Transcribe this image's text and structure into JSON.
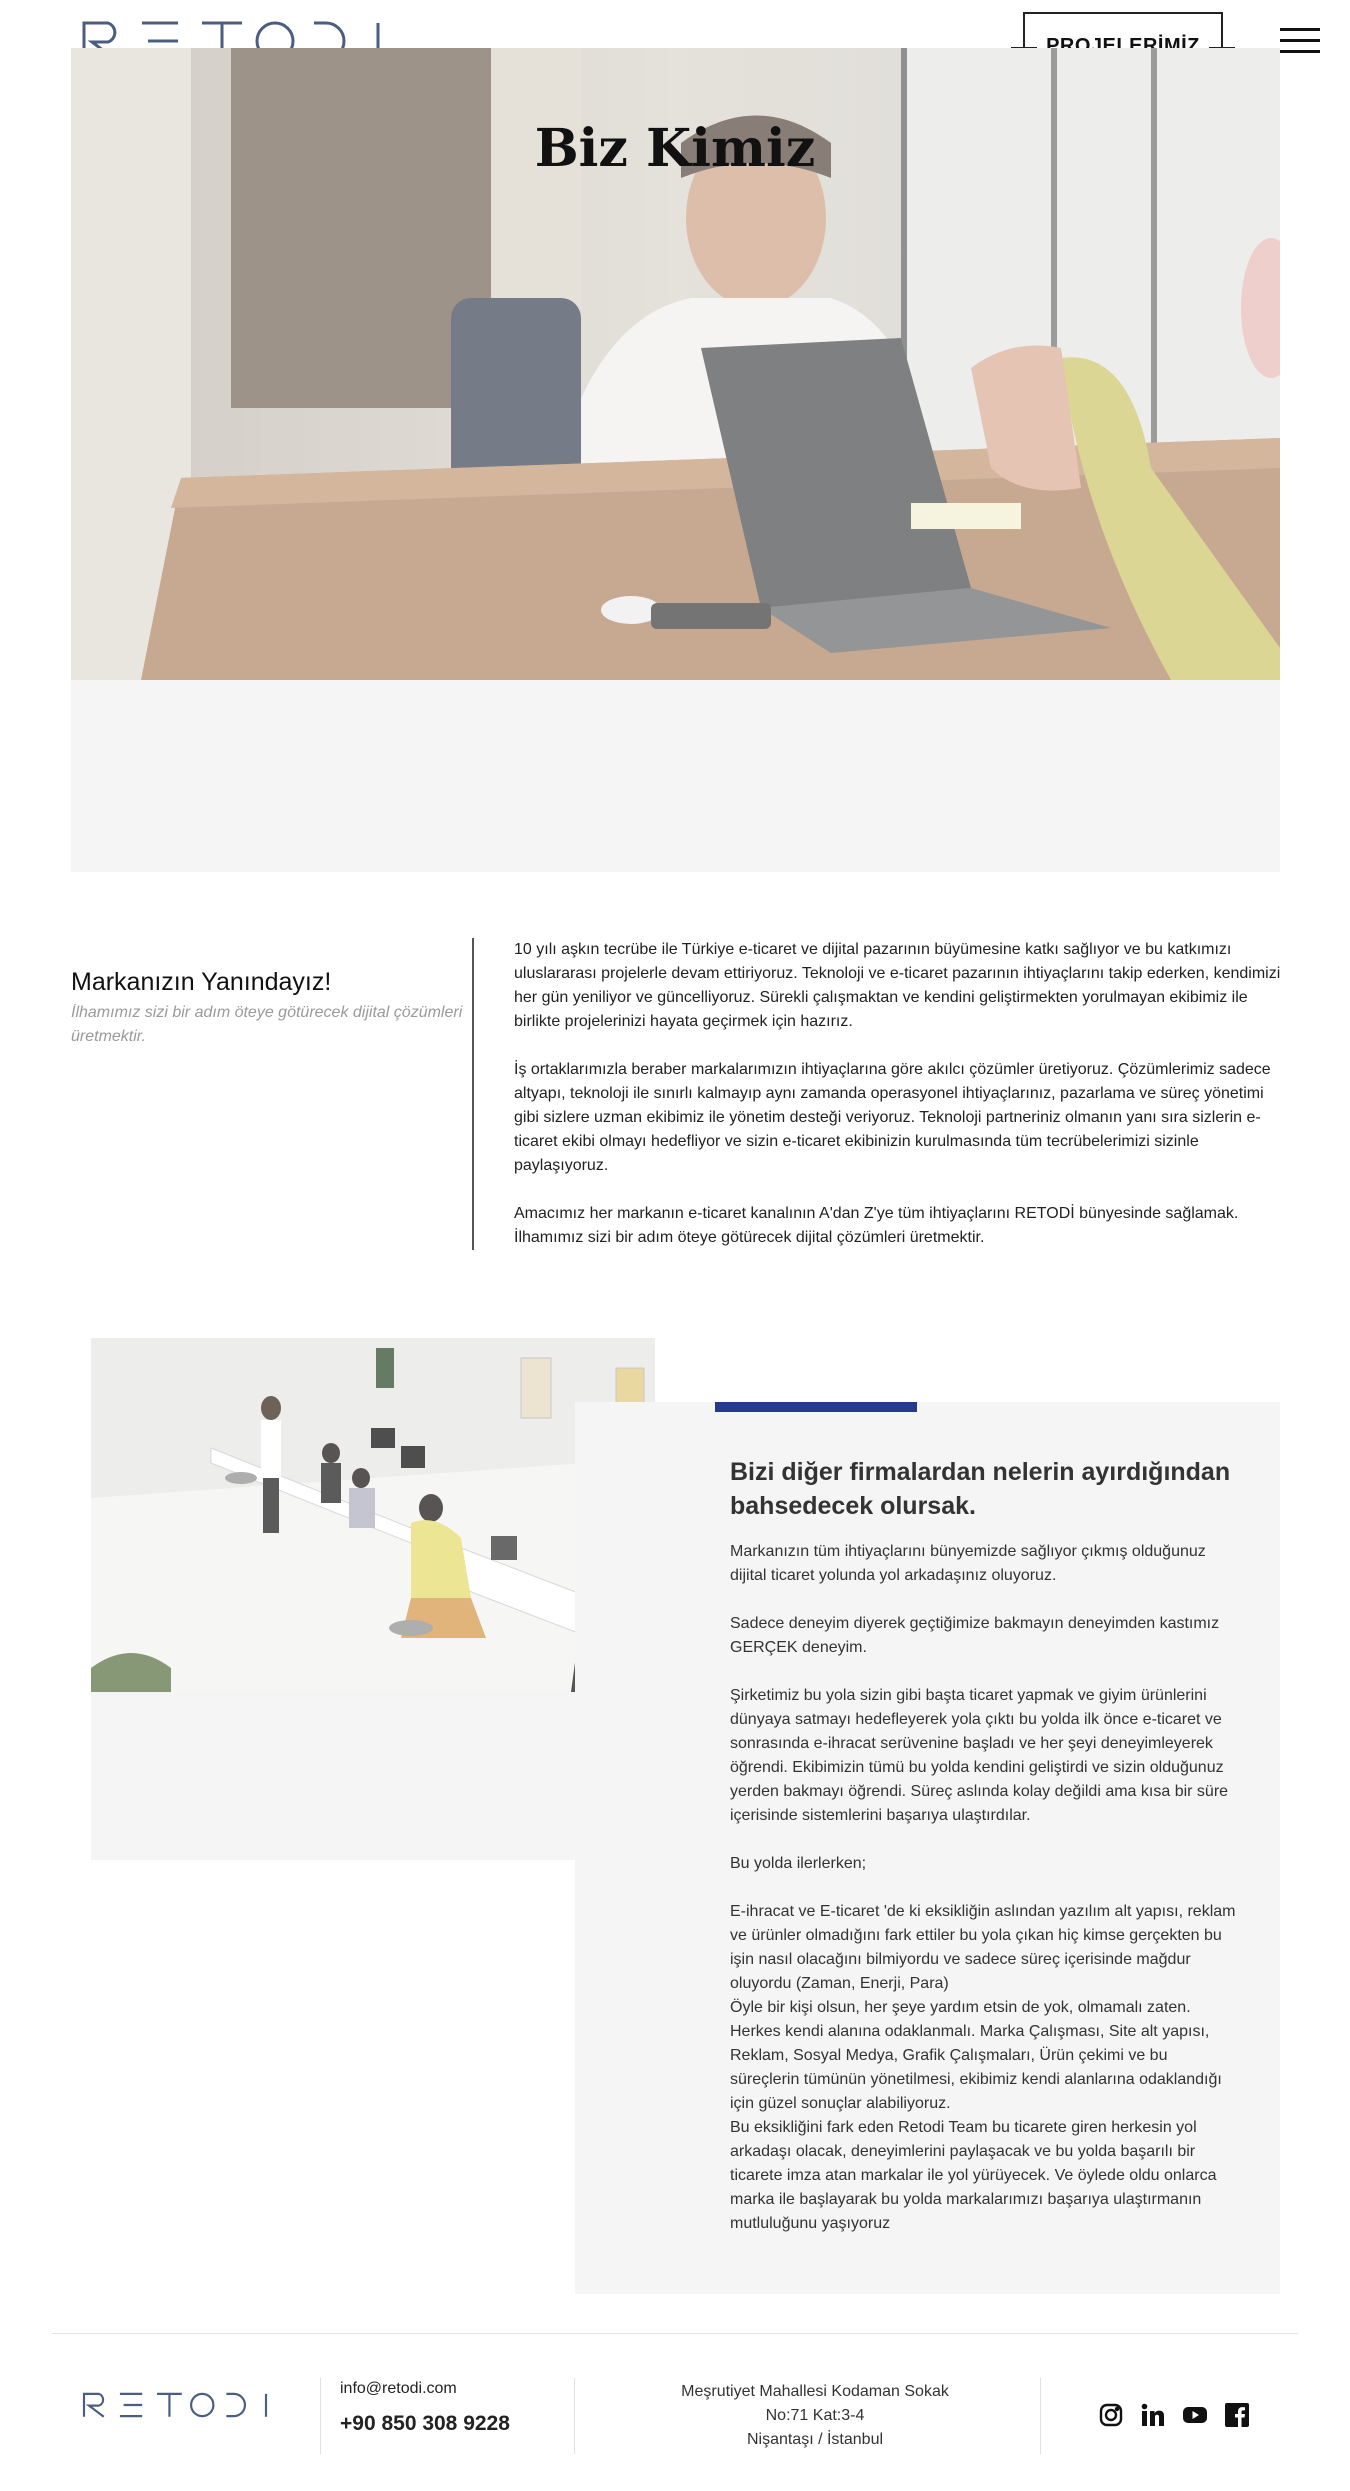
{
  "header": {
    "logo_text": "RETODI",
    "projects_button": "PROJELERİMİZ",
    "menu_icon": "hamburger-menu-icon"
  },
  "hero": {
    "title": "Biz Kimiz"
  },
  "about": {
    "heading": "Markanızın Yanındayız!",
    "subheading": "İlhamımız sizi bir adım öteye götürecek dijital çözümleri üretmektir.",
    "paragraphs": [
      "10 yılı aşkın tecrübe ile Türkiye e-ticaret ve dijital pazarının büyümesine katkı sağlıyor ve bu katkımızı uluslararası projelerle devam ettiriyoruz. Teknoloji ve e-ticaret pazarının ihtiyaçlarını takip ederken, kendimizi her gün yeniliyor ve güncelliyoruz. Sürekli çalışmaktan ve kendini geliştirmekten yorulmayan ekibimiz ile birlikte projelerinizi hayata geçirmek için hazırız.",
      "İş ortaklarımızla beraber markalarımızın ihtiyaçlarına göre akılcı çözümler üretiyoruz. Çözümlerimiz sadece altyapı, teknoloji ile sınırlı kalmayıp aynı zamanda operasyonel ihtiyaçlarınız, pazarlama ve süreç yönetimi gibi sizlere uzman ekibimiz ile yönetim desteği veriyoruz. Teknoloji partneriniz olmanın yanı sıra sizlerin e-ticaret ekibi olmayı hedefliyor ve sizin e-ticaret ekibinizin kurulmasında tüm tecrübelerimizi sizinle paylaşıyoruz.",
      "Amacımız her markanın e-ticaret kanalının A'dan Z'ye tüm ihtiyaçlarını RETODİ bünyesinde sağlamak. İlhamımız sizi bir adım öteye götürecek dijital çözümleri üretmektir."
    ]
  },
  "difference": {
    "title": "Bizi diğer firmalardan nelerin ayırdığından bahsedecek olursak.",
    "p1": "Markanızın tüm ihtiyaçlarını bünyemizde sağlıyor çıkmış olduğunuz dijital ticaret yolunda yol arkadaşınız oluyoruz.",
    "p2": "Sadece deneyim diyerek geçtiğimize bakmayın deneyimden kastımız GERÇEK deneyim.",
    "p3": "Şirketimiz bu yola sizin gibi başta ticaret yapmak ve giyim ürünlerini dünyaya satmayı hedefleyerek yola çıktı bu yolda ilk önce e-ticaret ve sonrasında e-ihracat serüvenine başladı ve her şeyi deneyimleyerek öğrendi. Ekibimizin tümü bu yolda kendini geliştirdi ve sizin olduğunuz yerden bakmayı öğrendi. Süreç aslında kolay değildi ama kısa bir süre içerisinde sistemlerini başarıya ulaştırdılar.",
    "p4": "Bu yolda ilerlerken;",
    "p5": "E-ihracat ve E-ticaret 'de ki eksikliğin aslından yazılım alt yapısı, reklam ve ürünler olmadığını fark ettiler bu yola çıkan hiç kimse gerçekten bu işin nasıl olacağını bilmiyordu ve sadece süreç içerisinde mağdur oluyordu (Zaman, Enerji, Para)",
    "p6": "Öyle bir kişi olsun, her şeye yardım etsin de yok, olmamalı zaten. Herkes kendi alanına odaklanmalı. Marka Çalışması, Site alt yapısı, Reklam, Sosyal Medya, Grafik Çalışmaları, Ürün çekimi ve bu süreçlerin tümünün yönetilmesi, ekibimiz kendi alanlarına odaklandığı için güzel sonuçlar alabiliyoruz.",
    "p7": "Bu eksikliğini fark eden Retodi Team bu ticarete giren herkesin yol arkadaşı olacak, deneyimlerini paylaşacak ve bu yolda başarılı bir ticarete imza atan markalar ile yol yürüyecek. Ve öylede oldu onlarca marka ile başlayarak bu yolda markalarımızı başarıya ulaştırmanın mutluluğunu yaşıyoruz"
  },
  "footer": {
    "logo_text": "RETODI",
    "email": "info@retodi.com",
    "phone": "+90 850 308 9228",
    "address_line1": "Meşrutiyet Mahallesi Kodaman Sokak",
    "address_line2": "No:71 Kat:3-4",
    "address_line3": "Nişantaşı / İstanbul",
    "social_icons": [
      "instagram-icon",
      "linkedin-icon",
      "youtube-icon",
      "facebook-icon"
    ]
  },
  "colors": {
    "accent_bar": "#243a8c",
    "logo_blue": "#4b5d80",
    "panel_gray": "#f5f5f6"
  }
}
